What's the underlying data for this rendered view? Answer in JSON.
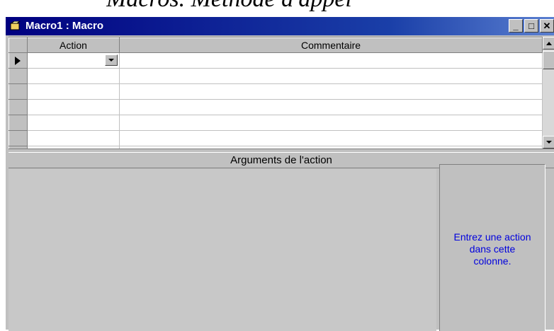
{
  "caption": {
    "visible_text": "Macros. Méthode d'appel"
  },
  "window": {
    "title": "Macro1 : Macro",
    "controls": {
      "minimize": "_",
      "maximize": "□",
      "close": "✕"
    }
  },
  "grid": {
    "columns": [
      "Action",
      "Commentaire"
    ],
    "rows": [
      {
        "action": "",
        "comment": ""
      },
      {
        "action": "",
        "comment": ""
      },
      {
        "action": "",
        "comment": ""
      },
      {
        "action": "",
        "comment": ""
      },
      {
        "action": "",
        "comment": ""
      },
      {
        "action": "",
        "comment": ""
      },
      {
        "action": "",
        "comment": ""
      }
    ]
  },
  "arguments": {
    "header": "Arguments de l'action",
    "hint": "Entrez une action dans cette colonne."
  },
  "icons": {
    "window_icon": "macro-icon"
  }
}
